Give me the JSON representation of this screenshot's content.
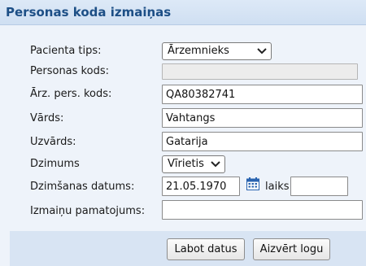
{
  "dialog": {
    "title": "Personas koda izmaiņas"
  },
  "form": {
    "patient_type": {
      "label": "Pacienta tips:",
      "value": "Ārzemnieks"
    },
    "personal_code": {
      "label": "Personas kods:",
      "value": ""
    },
    "foreign_code": {
      "label": "Ārz. pers. kods:",
      "value": "QA80382741"
    },
    "first_name": {
      "label": "Vārds:",
      "value": "Vahtangs"
    },
    "last_name": {
      "label": "Uzvārds:",
      "value": "Gatarija"
    },
    "gender": {
      "label": "Dzimums",
      "value": "Vīrietis"
    },
    "birth_date": {
      "label": "Dzimšanas datums:",
      "value": "21.05.1970"
    },
    "time": {
      "label": "laiks",
      "value": ""
    },
    "reason": {
      "label": "Izmaiņu pamatojums:",
      "value": ""
    }
  },
  "buttons": {
    "save": "Labot datus",
    "close": "Aizvērt logu"
  },
  "icons": {
    "calendar": "calendar-icon",
    "dropdown": "chevron-down-icon"
  },
  "colors": {
    "title_text": "#1d4f86",
    "panel_bg": "#eef3fa",
    "footer_bg": "#d8e4f3"
  }
}
